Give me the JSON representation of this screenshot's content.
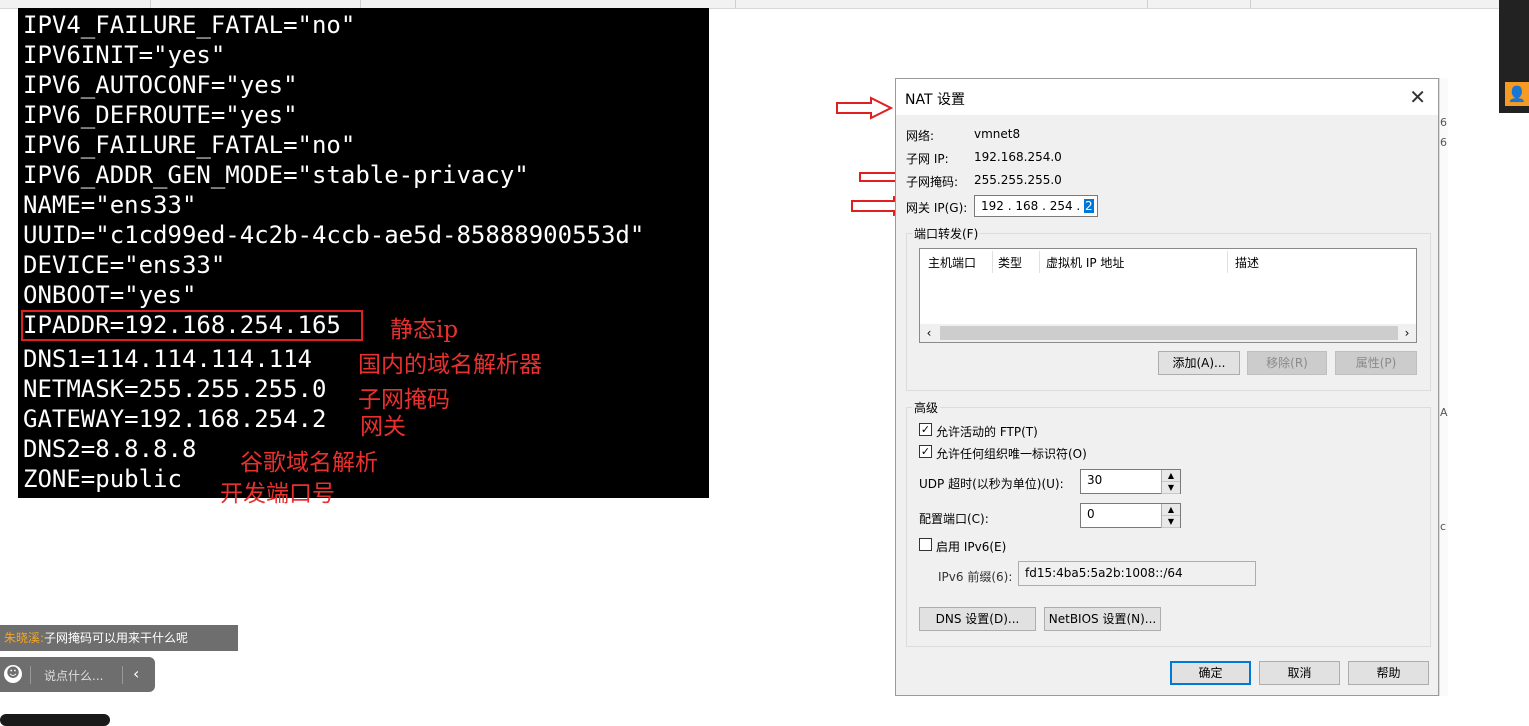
{
  "terminal": {
    "lines": [
      "IPV4_FAILURE_FATAL=\"no\"",
      "IPV6INIT=\"yes\"",
      "IPV6_AUTOCONF=\"yes\"",
      "IPV6_DEFROUTE=\"yes\"",
      "IPV6_FAILURE_FATAL=\"no\"",
      "IPV6_ADDR_GEN_MODE=\"stable-privacy\"",
      "NAME=\"ens33\"",
      "UUID=\"c1cd99ed-4c2b-4ccb-ae5d-85888900553d\"",
      "DEVICE=\"ens33\"",
      "ONBOOT=\"yes\"",
      "IPADDR=192.168.254.165",
      "DNS1=114.114.114.114",
      "NETMASK=255.255.255.0",
      "GATEWAY=192.168.254.2",
      "DNS2=8.8.8.8",
      "ZONE=public"
    ]
  },
  "annotations": {
    "static_ip": "静态ip",
    "dns1": "国内的域名解析器",
    "netmask": "子网掩码",
    "gateway": "网关",
    "dns2": "谷歌域名解析",
    "zone": "开发端口号"
  },
  "dialog": {
    "title": "NAT 设置",
    "network_label": "网络:",
    "network_value": "vmnet8",
    "subnet_ip_label": "子网 IP:",
    "subnet_ip_value": "192.168.254.0",
    "subnet_mask_label": "子网掩码:",
    "subnet_mask_value": "255.255.255.0",
    "gateway_label": "网关 IP(G):",
    "gateway_value_prefix": "192 . 168 . 254 . ",
    "gateway_value_last": "2",
    "port_forward_group": "端口转发(F)",
    "columns": [
      "主机端口",
      "类型",
      "虚拟机 IP 地址",
      "描述"
    ],
    "add_button": "添加(A)...",
    "remove_button": "移除(R)",
    "properties_button": "属性(P)",
    "advanced_group": "高级",
    "allow_ftp": "允许活动的 FTP(T)",
    "allow_any_oui": "允许任何组织唯一标识符(O)",
    "udp_timeout_label": "UDP 超时(以秒为单位)(U):",
    "udp_timeout_value": "30",
    "config_port_label": "配置端口(C):",
    "config_port_value": "0",
    "enable_ipv6": "启用 IPv6(E)",
    "ipv6_prefix_label": "IPv6 前缀(6):",
    "ipv6_prefix_value": "fd15:4ba5:5a2b:1008::/64",
    "dns_button": "DNS 设置(D)...",
    "netbios_button": "NetBIOS 设置(N)...",
    "ok_button": "确定",
    "cancel_button": "取消",
    "help_button": "帮助"
  },
  "chat": {
    "username": "朱晓溪:",
    "message": "子网掩码可以用来干什么呢",
    "input_placeholder": "说点什么..."
  },
  "colors": {
    "annotation_red": "#e8302f",
    "accent_blue": "#0078d7",
    "username_orange": "#f5a623"
  }
}
